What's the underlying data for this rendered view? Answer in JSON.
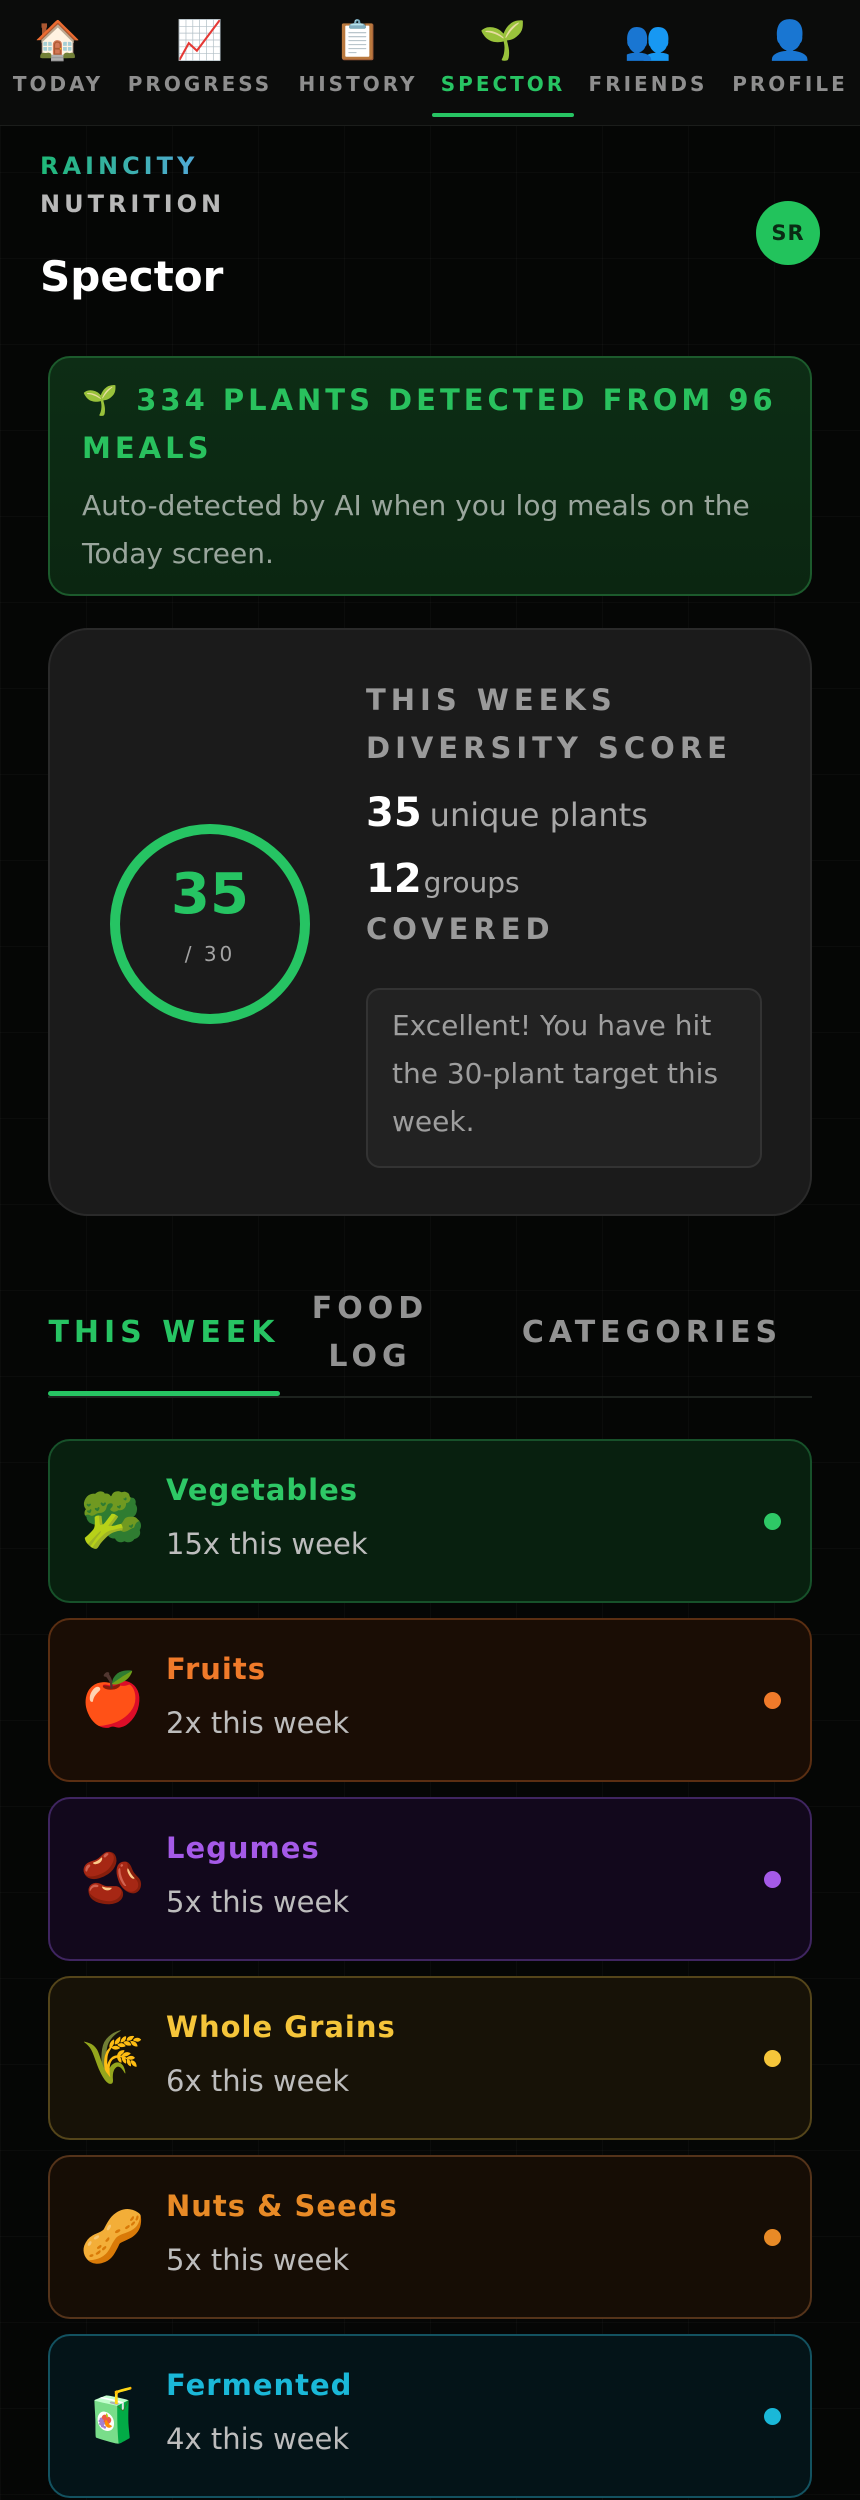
{
  "nav": {
    "items": [
      {
        "icon": "🏠",
        "label": "TODAY",
        "icon_name": "house-icon"
      },
      {
        "icon": "📈",
        "label": "PROGRESS",
        "icon_name": "chart-up-icon"
      },
      {
        "icon": "📋",
        "label": "HISTORY",
        "icon_name": "clipboard-icon"
      },
      {
        "icon": "🌱",
        "label": "SPECTOR",
        "icon_name": "seedling-icon"
      },
      {
        "icon": "👥",
        "label": "FRIENDS",
        "icon_name": "people-icon"
      },
      {
        "icon": "👤",
        "label": "PROFILE",
        "icon_name": "person-icon"
      }
    ],
    "active": "SPECTOR"
  },
  "header": {
    "brand_line1": "RAINCITY",
    "brand_line2": "NUTRITION",
    "title": "Spector",
    "avatar_initials": "SR"
  },
  "detected": {
    "icon": "🌱",
    "title": "334 PLANTS DETECTED FROM 96 MEALS",
    "plants": 334,
    "meals": 96,
    "text": "Auto-detected by AI when you log meals on the Today screen."
  },
  "score": {
    "heading": "THIS WEEKS DIVERSITY SCORE",
    "value": "35",
    "total": "/ 30",
    "progress_fraction": 1.0,
    "unique_count": "35",
    "unique_label": "unique plants",
    "groups_count": "12",
    "groups_label": "groups",
    "covered_label": "COVERED",
    "message": "Excellent! You have hit the 30-plant target this week."
  },
  "tabs": [
    {
      "label": "THIS WEEK",
      "active": true
    },
    {
      "label": "FOOD LOG",
      "active": false
    },
    {
      "label": "CATEGORIES",
      "active": false
    }
  ],
  "categories": [
    {
      "icon": "🥦",
      "icon_name": "broccoli-icon",
      "name": "Vegetables",
      "count": "15x this week",
      "color": "#2ec866",
      "bg": "#08200f",
      "border": "#17512a"
    },
    {
      "icon": "🍎",
      "icon_name": "apple-icon",
      "name": "Fruits",
      "count": "2x this week",
      "color": "#f07a2a",
      "bg": "#1a0d05",
      "border": "#5a2e12"
    },
    {
      "icon": "🫘",
      "icon_name": "beans-icon",
      "name": "Legumes",
      "count": "5x this week",
      "color": "#a55ae8",
      "bg": "#12081c",
      "border": "#3f2560"
    },
    {
      "icon": "🌾",
      "icon_name": "wheat-icon",
      "name": "Whole Grains",
      "count": "6x this week",
      "color": "#f5c53a",
      "bg": "#171207",
      "border": "#54451a"
    },
    {
      "icon": "🥜",
      "icon_name": "peanut-icon",
      "name": "Nuts & Seeds",
      "count": "5x this week",
      "color": "#e88a26",
      "bg": "#160d05",
      "border": "#54331a"
    },
    {
      "icon": "🧃",
      "icon_name": "juice-box-icon",
      "name": "Fermented",
      "count": "4x this week",
      "color": "#1ab8d8",
      "bg": "#041418",
      "border": "#135260"
    }
  ]
}
